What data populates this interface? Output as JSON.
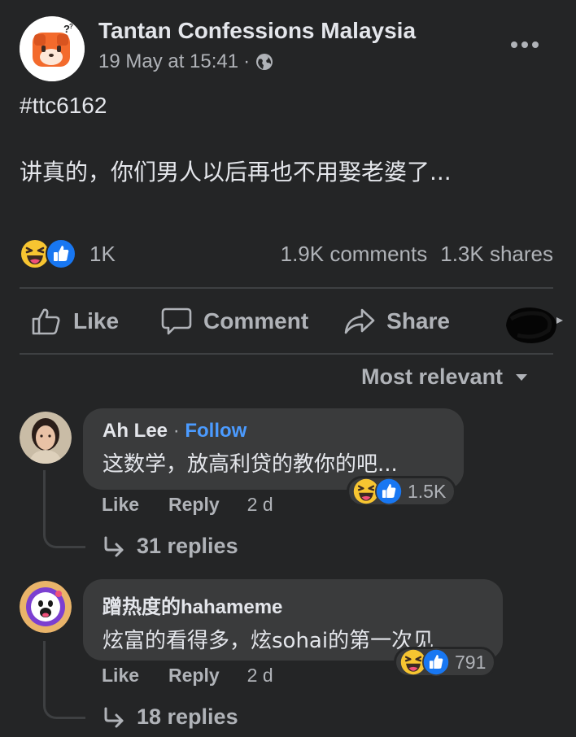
{
  "post": {
    "page_name": "Tantan Confessions Malaysia",
    "timestamp": "19 May at 15:41",
    "separator": "·",
    "privacy_icon": "globe-icon",
    "hashtag": "#ttc6162",
    "text": "讲真的，你们男人以后再也不用娶老婆了...",
    "reaction_icons": [
      "haha-icon",
      "like-icon"
    ],
    "reaction_count": "1K",
    "comments": "1.9K comments",
    "shares": "1.3K shares"
  },
  "actions": {
    "like": "Like",
    "comment": "Comment",
    "share": "Share"
  },
  "sort": {
    "label": "Most relevant"
  },
  "comments": [
    {
      "author": "Ah Lee",
      "separator": "·",
      "follow": "Follow",
      "text": "这数学，放高利贷的教你的吧...",
      "like": "Like",
      "reply": "Reply",
      "time": "2 d",
      "reaction_count": "1.5K",
      "replies": "31 replies"
    },
    {
      "author": "蹭热度的hahameme",
      "text": "炫富的看得多，炫sohai的第一次见",
      "like": "Like",
      "reply": "Reply",
      "time": "2 d",
      "reaction_count": "791",
      "replies": "18 replies"
    }
  ],
  "colors": {
    "background": "#242526",
    "bubble": "#3a3b3c",
    "primary_text": "#e4e6eb",
    "secondary_text": "#b0b3b8",
    "link_blue": "#4b9bff",
    "like_blue": "#1877f2",
    "haha_yellow": "#f7c531"
  }
}
